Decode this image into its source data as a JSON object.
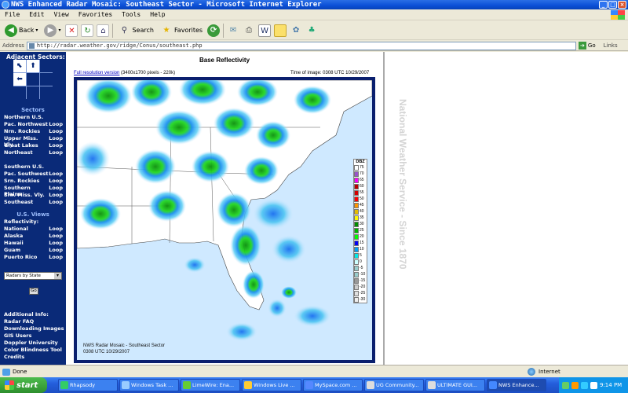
{
  "window": {
    "title": "NWS Enhanced Radar Mosaic: Southeast Sector - Microsoft Internet Explorer"
  },
  "menu": [
    "File",
    "Edit",
    "View",
    "Favorites",
    "Tools",
    "Help"
  ],
  "toolbar": {
    "back": "Back",
    "search": "Search",
    "favorites": "Favorites"
  },
  "address": {
    "label": "Address",
    "url": "http://radar.weather.gov/ridge/Conus/southeast.php",
    "go": "Go",
    "links": "Links"
  },
  "sidebar": {
    "adjacent_title": "Adjacent Sectors:",
    "sectors_title": "Sectors",
    "group1_title": "Northern U.S.",
    "group1": [
      {
        "label": "Pac. Northwest",
        "loop": "Loop"
      },
      {
        "label": "Nrn. Rockies",
        "loop": "Loop"
      },
      {
        "label": "Upper Miss. Vly.",
        "loop": "Loop"
      },
      {
        "label": "Great Lakes",
        "loop": "Loop"
      },
      {
        "label": "Northeast",
        "loop": "Loop"
      }
    ],
    "group2_title": "Southern U.S.",
    "group2": [
      {
        "label": "Pac. Southwest",
        "loop": "Loop"
      },
      {
        "label": "Srn. Rockies",
        "loop": "Loop"
      },
      {
        "label": "Southern Plains",
        "loop": "Loop"
      },
      {
        "label": "Srn. Miss. Vly.",
        "loop": "Loop"
      },
      {
        "label": "Southeast",
        "loop": "Loop"
      }
    ],
    "views_title": "U.S. Views",
    "reflectivity": "Reflectivity:",
    "views": [
      {
        "label": "National",
        "loop": "Loop"
      },
      {
        "label": "Alaska",
        "loop": "Loop"
      },
      {
        "label": "Hawaii",
        "loop": "Loop"
      },
      {
        "label": "Guam",
        "loop": "Loop"
      },
      {
        "label": "Puerto Rico",
        "loop": "Loop"
      }
    ],
    "select_value": "Radars by State",
    "go": "Go",
    "info_title": "Additional Info:",
    "info": [
      "Radar FAQ",
      "Downloading Images",
      "GIS Users",
      "Doppler University",
      "Color Blindness Tool",
      "Credits"
    ]
  },
  "page": {
    "title": "Base Reflectivity",
    "full_res_link": "Full resolution version",
    "full_res_detail": "(3400x1700 pixels - 220k)",
    "time_of_image": "Time of image: 0308 UTC 10/29/2007",
    "caption_line1": "NWS Radar Mosaic - Southeast Sector",
    "caption_line2": "0308 UTC 10/29/2007",
    "watermark": "National Weather Service - Since 1870"
  },
  "legend": {
    "title": "DBZ",
    "levels": [
      {
        "v": "75",
        "c": "#ffffff"
      },
      {
        "v": "70",
        "c": "#9955c9"
      },
      {
        "v": "65",
        "c": "#f800fd"
      },
      {
        "v": "60",
        "c": "#bc0000"
      },
      {
        "v": "55",
        "c": "#d40000"
      },
      {
        "v": "50",
        "c": "#fd0000"
      },
      {
        "v": "45",
        "c": "#fd9500"
      },
      {
        "v": "40",
        "c": "#e5bc00"
      },
      {
        "v": "35",
        "c": "#fdf802"
      },
      {
        "v": "30",
        "c": "#008e00"
      },
      {
        "v": "25",
        "c": "#01b501"
      },
      {
        "v": "20",
        "c": "#02fd02"
      },
      {
        "v": "15",
        "c": "#0300f4"
      },
      {
        "v": "10",
        "c": "#019ff4"
      },
      {
        "v": "5",
        "c": "#04e9e7"
      },
      {
        "v": "0",
        "c": "#ccffff"
      },
      {
        "v": "-5",
        "c": "#99cccc"
      },
      {
        "v": "-10",
        "c": "#99cccc"
      },
      {
        "v": "-15",
        "c": "#999999"
      },
      {
        "v": "-20",
        "c": "#cccccc"
      },
      {
        "v": "-25",
        "c": "#e0e0e0"
      },
      {
        "v": "-30",
        "c": "#eeeeee"
      }
    ]
  },
  "status": {
    "text": "Done",
    "zone": "Internet"
  },
  "taskbar": {
    "start": "start",
    "tasks": [
      "Rhapsody",
      "Windows Task ...",
      "LimeWire: Ena...",
      "Windows Live ...",
      "MySpace.com ...",
      "UG Community...",
      "ULTIMATE GUI...",
      "NWS Enhance..."
    ],
    "clock": "9:14 PM"
  }
}
